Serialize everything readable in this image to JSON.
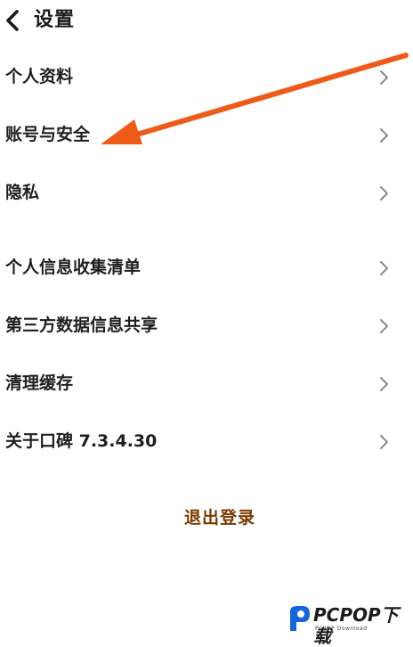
{
  "header": {
    "back_icon": "chevron-left-icon",
    "title": "设置"
  },
  "menu": [
    {
      "label": "个人资料",
      "icon": "chevron-right-icon"
    },
    {
      "label": "账号与安全",
      "icon": "chevron-right-icon"
    },
    {
      "label": "隐私",
      "icon": "chevron-right-icon"
    },
    {
      "label": "个人信息收集清单",
      "icon": "chevron-right-icon"
    },
    {
      "label": "第三方数据信息共享",
      "icon": "chevron-right-icon"
    },
    {
      "label": "清理缓存",
      "icon": "chevron-right-icon"
    },
    {
      "label": "关于口碑 7.3.4.30",
      "icon": "chevron-right-icon"
    }
  ],
  "logout_label": "退出登录",
  "watermark": {
    "brand": "PCPOP下载",
    "sub": "PCPOP Download",
    "colors": {
      "blue": "#1565d8",
      "dark": "#1b1b1b"
    }
  },
  "colors": {
    "background": "#ffffff",
    "text": "#1f1f1f",
    "chevron": "#8a8a8a",
    "logout": "#7a3a00",
    "annotation_arrow": "#ee5a18"
  }
}
